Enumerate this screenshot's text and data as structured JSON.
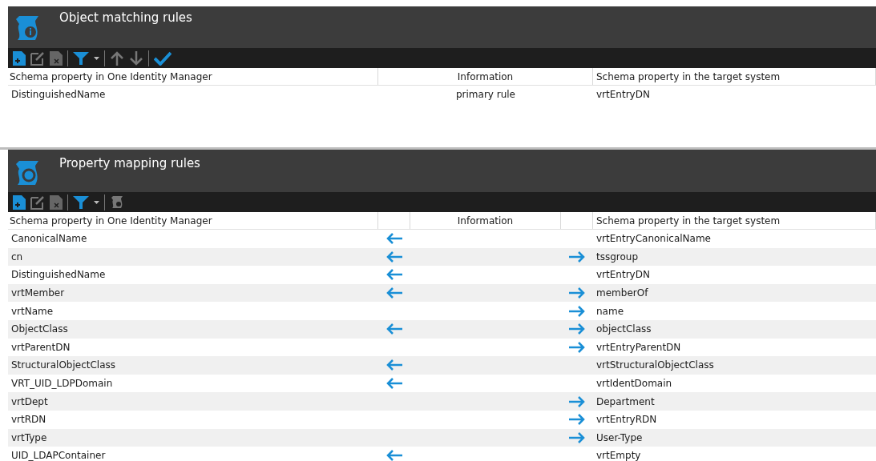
{
  "matching": {
    "title": "Object matching rules",
    "columns": [
      "Schema property in One Identity Manager",
      "Information",
      "Schema property in the target system"
    ],
    "rows": [
      {
        "source": "DistinguishedName",
        "information": "primary rule",
        "target": "vrtEntryDN"
      }
    ]
  },
  "mapping": {
    "title": "Property mapping rules",
    "columns": [
      "Schema property in One Identity Manager",
      "Information",
      "Schema property in the target system"
    ],
    "rows": [
      {
        "source": "CanonicalName",
        "to_source": true,
        "to_target": false,
        "target": "vrtEntryCanonicalName"
      },
      {
        "source": "cn",
        "to_source": true,
        "to_target": true,
        "target": "tssgroup"
      },
      {
        "source": "DistinguishedName",
        "to_source": true,
        "to_target": false,
        "target": "vrtEntryDN"
      },
      {
        "source": "vrtMember",
        "to_source": true,
        "to_target": true,
        "target": "memberOf"
      },
      {
        "source": "vrtName",
        "to_source": false,
        "to_target": true,
        "target": "name"
      },
      {
        "source": "ObjectClass",
        "to_source": true,
        "to_target": true,
        "target": "objectClass"
      },
      {
        "source": "vrtParentDN",
        "to_source": false,
        "to_target": true,
        "target": "vrtEntryParentDN"
      },
      {
        "source": "StructuralObjectClass",
        "to_source": true,
        "to_target": false,
        "target": "vrtStructuralObjectClass"
      },
      {
        "source": "VRT_UID_LDPDomain",
        "to_source": true,
        "to_target": false,
        "target": "vrtIdentDomain"
      },
      {
        "source": "vrtDept",
        "to_source": false,
        "to_target": true,
        "target": "Department"
      },
      {
        "source": "vrtRDN",
        "to_source": false,
        "to_target": true,
        "target": "vrtEntryRDN"
      },
      {
        "source": "vrtType",
        "to_source": false,
        "to_target": true,
        "target": "User-Type"
      },
      {
        "source": "UID_LDAPContainer",
        "to_source": true,
        "to_target": false,
        "target": "vrtEmpty"
      }
    ]
  }
}
